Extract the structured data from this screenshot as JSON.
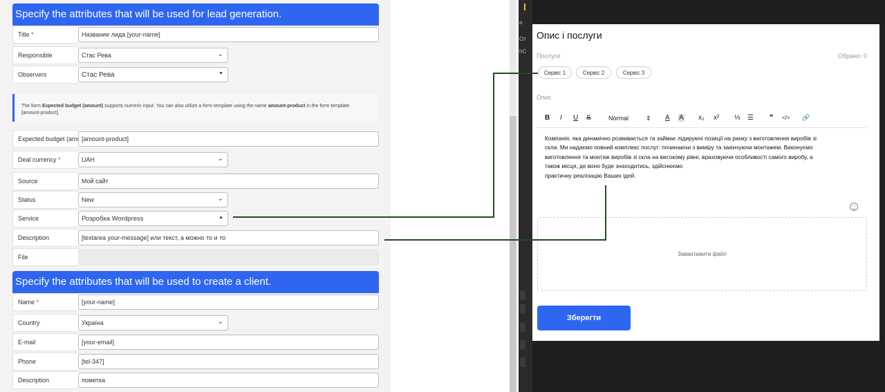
{
  "lead_section": {
    "header": "Specify the attributes that will be used for lead generation.",
    "rows": [
      {
        "label": "Title",
        "required": true,
        "value": "Название лида [your-name]",
        "type": "text"
      },
      {
        "label": "Responsible",
        "required": false,
        "value": "Стас Рева",
        "type": "select"
      },
      {
        "label": "Observers",
        "required": false,
        "value": "Стас Рева",
        "type": "select-small"
      }
    ],
    "info_parts": {
      "p1": "The form ",
      "b1": "Expected budget (amount)",
      "p2": " supports numeric input. You can also utilize a form template using the name ",
      "b2": "amount-product",
      "p3": " in the form template.",
      "line2": "[amount-product]"
    },
    "rows2": [
      {
        "label": "Expected budget (amo",
        "required": false,
        "value": "[amount-product]",
        "type": "text"
      },
      {
        "label": "Deal currency",
        "required": true,
        "value": "UAH",
        "type": "select"
      },
      {
        "label": "Source",
        "required": false,
        "value": "Мой сайт",
        "type": "text"
      },
      {
        "label": "Status",
        "required": false,
        "value": "New",
        "type": "select"
      },
      {
        "label": "Service",
        "required": false,
        "value": "Розробка Wordpress",
        "type": "select-open"
      },
      {
        "label": "Description",
        "required": false,
        "value": "[textarea your-message] или текст, а можно то и то",
        "type": "text"
      },
      {
        "label": "File",
        "required": false,
        "value": "",
        "type": "disabled"
      }
    ]
  },
  "client_section": {
    "header": "Specify the attributes that will be used to create a client.",
    "rows": [
      {
        "label": "Name",
        "required": true,
        "value": "[your-name]",
        "type": "text"
      },
      {
        "label": "Country",
        "required": false,
        "value": "Україна",
        "type": "select"
      },
      {
        "label": "E-mail",
        "required": false,
        "value": "[your-email]",
        "type": "text"
      },
      {
        "label": "Phone",
        "required": false,
        "value": "[tel-347]",
        "type": "text"
      },
      {
        "label": "Description",
        "required": false,
        "value": "пометка",
        "type": "text"
      }
    ]
  },
  "required_mark": "*",
  "dark_panel": {
    "snippets": [
      "а",
      "От",
      "hC"
    ]
  },
  "modal": {
    "title": "Опис і послуги",
    "services_label": "Послуги",
    "selected_count": "Обрано: 0",
    "services": [
      "Сервіс 1",
      "Сервіс 2",
      "Сервіс 3"
    ],
    "description_label": "Опис",
    "toolbar": {
      "bold": "B",
      "italic": "I",
      "underline": "U",
      "strike": "S",
      "format": "Normal",
      "format_arrows": "⇕",
      "text_color": "A",
      "bg_color": "A",
      "subscript": "x₂",
      "superscript": "x²",
      "ordered_list": "⅓",
      "bullet_list": "☰",
      "quote": "❞",
      "code": "</>",
      "link": "🔗"
    },
    "text_lines": [
      "Компанія, яка динамічно розвивається та займає лідируючі позиції на ринку з виготовлення виробів зі",
      "скла. Ми надаємо повний комплекс послуг: починаючи з виміру та закінчуючи монтажем. Виконуємо",
      "виготовлення та монтаж виробів зі скла на високому рівні, враховуючи особливості самого виробу, а",
      "також місця, де воно буде знаходитись, здійснюємо",
      "практичну реалізацію Ваших ідей."
    ],
    "upload_label": "Завантажити файл",
    "save_button": "Зберегти"
  },
  "colors": {
    "accent": "#2f66f0",
    "connector": "#1f4d1f",
    "dark_bg": "#1f1f1f"
  }
}
